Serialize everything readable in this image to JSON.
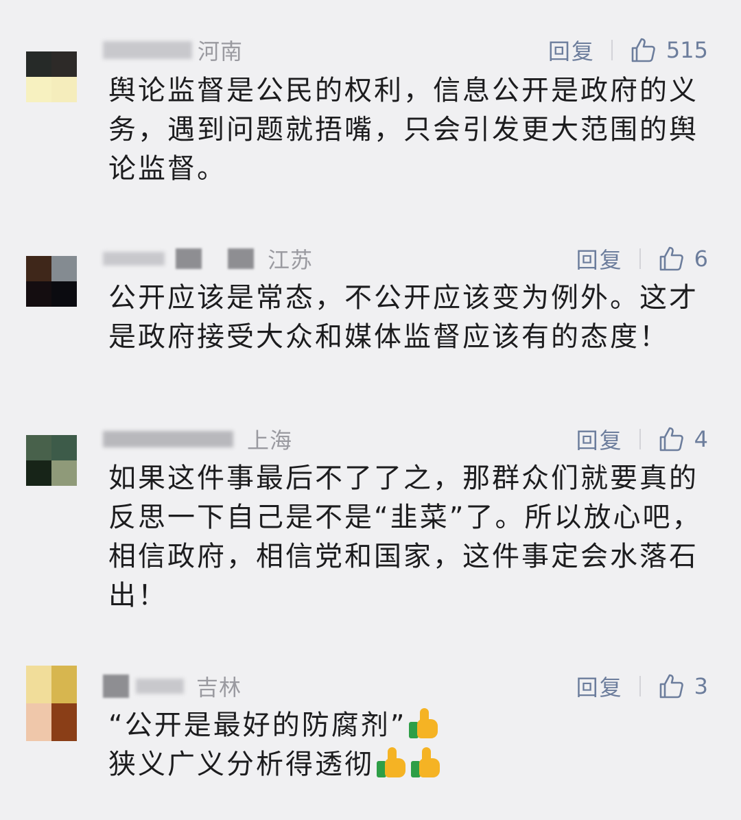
{
  "colors": {
    "background": "#f0f0f2",
    "text": "#1c1c1e",
    "meta": "#9a9aa0",
    "action": "#6c7d9c"
  },
  "reply_label": "回复",
  "like_icon": "thumbs-up-outline-icon",
  "comments": [
    {
      "location": "河南",
      "likes": "515",
      "text": "舆论监督是公民的权利，信息公开是政府的义\n务，遇到问题就捂嘴，只会引发更大范围的舆\n论监督。",
      "avatar_colors": [
        "#262a28",
        "#2d2a28",
        "#f7f1c0",
        "#f5edbc"
      ]
    },
    {
      "location": "江苏",
      "likes": "6",
      "text": "公开应该是常态，不公开应该变为例外。这才\n是政府接受大众和媒体监督应该有的态度！",
      "avatar_colors": [
        "#3f271a",
        "#848b91",
        "#140d10",
        "#0b0b10"
      ]
    },
    {
      "location": "上海",
      "likes": "4",
      "text": "如果这件事最后不了了之，那群众们就要真的\n反思一下自己是不是“韭菜”了。所以放心吧，\n相信政府，相信党和国家，这件事定会水落石\n出！",
      "avatar_colors": [
        "#48614b",
        "#3d5b49",
        "#172418",
        "#8f9a79"
      ]
    },
    {
      "location": "吉林",
      "likes": "3",
      "text_line1": "“公开是最好的防腐剂”",
      "text_line2": "狭义广义分析得透彻",
      "emoji": "thumbs-up-emoji",
      "avatar_colors": [
        "#f1dd9a",
        "#d7b64f",
        "#efc7aa",
        "#8a3e17"
      ]
    }
  ]
}
